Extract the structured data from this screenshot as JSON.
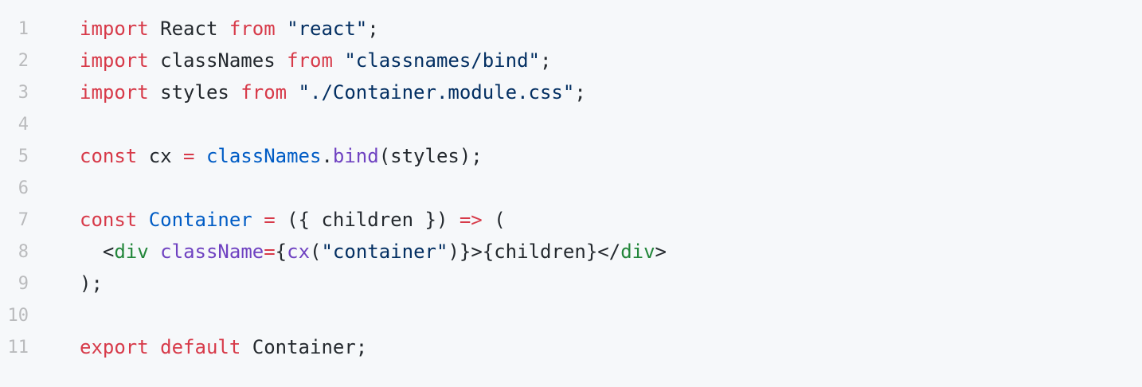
{
  "code": {
    "lines": [
      {
        "number": "1",
        "tokens": [
          {
            "text": "import",
            "type": "kw"
          },
          {
            "text": " React ",
            "type": "plain"
          },
          {
            "text": "from",
            "type": "kw"
          },
          {
            "text": " ",
            "type": "plain"
          },
          {
            "text": "\"react\"",
            "type": "str"
          },
          {
            "text": ";",
            "type": "plain"
          }
        ]
      },
      {
        "number": "2",
        "tokens": [
          {
            "text": "import",
            "type": "kw"
          },
          {
            "text": " classNames ",
            "type": "plain"
          },
          {
            "text": "from",
            "type": "kw"
          },
          {
            "text": " ",
            "type": "plain"
          },
          {
            "text": "\"classnames/bind\"",
            "type": "str"
          },
          {
            "text": ";",
            "type": "plain"
          }
        ]
      },
      {
        "number": "3",
        "tokens": [
          {
            "text": "import",
            "type": "kw"
          },
          {
            "text": " styles ",
            "type": "plain"
          },
          {
            "text": "from",
            "type": "kw"
          },
          {
            "text": " ",
            "type": "plain"
          },
          {
            "text": "\"./Container.module.css\"",
            "type": "str"
          },
          {
            "text": ";",
            "type": "plain"
          }
        ]
      },
      {
        "number": "4",
        "tokens": []
      },
      {
        "number": "5",
        "tokens": [
          {
            "text": "const",
            "type": "kw"
          },
          {
            "text": " cx ",
            "type": "plain"
          },
          {
            "text": "=",
            "type": "kw"
          },
          {
            "text": " ",
            "type": "plain"
          },
          {
            "text": "classNames",
            "type": "cls"
          },
          {
            "text": ".",
            "type": "plain"
          },
          {
            "text": "bind",
            "type": "fn"
          },
          {
            "text": "(styles);",
            "type": "plain"
          }
        ]
      },
      {
        "number": "6",
        "tokens": []
      },
      {
        "number": "7",
        "tokens": [
          {
            "text": "const",
            "type": "kw"
          },
          {
            "text": " ",
            "type": "plain"
          },
          {
            "text": "Container",
            "type": "cls"
          },
          {
            "text": " ",
            "type": "plain"
          },
          {
            "text": "=",
            "type": "kw"
          },
          {
            "text": " ({ children }) ",
            "type": "plain"
          },
          {
            "text": "=>",
            "type": "kw"
          },
          {
            "text": " (",
            "type": "plain"
          }
        ]
      },
      {
        "number": "8",
        "tokens": [
          {
            "text": "  <",
            "type": "plain"
          },
          {
            "text": "div",
            "type": "tag"
          },
          {
            "text": " ",
            "type": "plain"
          },
          {
            "text": "className",
            "type": "fn"
          },
          {
            "text": "=",
            "type": "kw"
          },
          {
            "text": "{",
            "type": "plain"
          },
          {
            "text": "cx",
            "type": "fn"
          },
          {
            "text": "(",
            "type": "plain"
          },
          {
            "text": "\"container\"",
            "type": "str"
          },
          {
            "text": ")}>{children}</",
            "type": "plain"
          },
          {
            "text": "div",
            "type": "tag"
          },
          {
            "text": ">",
            "type": "plain"
          }
        ]
      },
      {
        "number": "9",
        "tokens": [
          {
            "text": ");",
            "type": "plain"
          }
        ]
      },
      {
        "number": "10",
        "tokens": []
      },
      {
        "number": "11",
        "tokens": [
          {
            "text": "export",
            "type": "kw"
          },
          {
            "text": " ",
            "type": "plain"
          },
          {
            "text": "default",
            "type": "kw"
          },
          {
            "text": " Container;",
            "type": "plain"
          }
        ]
      }
    ]
  },
  "colors": {
    "background": "#f6f8fa",
    "line_number": "#babbbd",
    "keyword": "#d73a49",
    "string": "#032f62",
    "function": "#6f42c1",
    "identifier": "#005cc5",
    "tag": "#22863a",
    "plain": "#24292e"
  }
}
